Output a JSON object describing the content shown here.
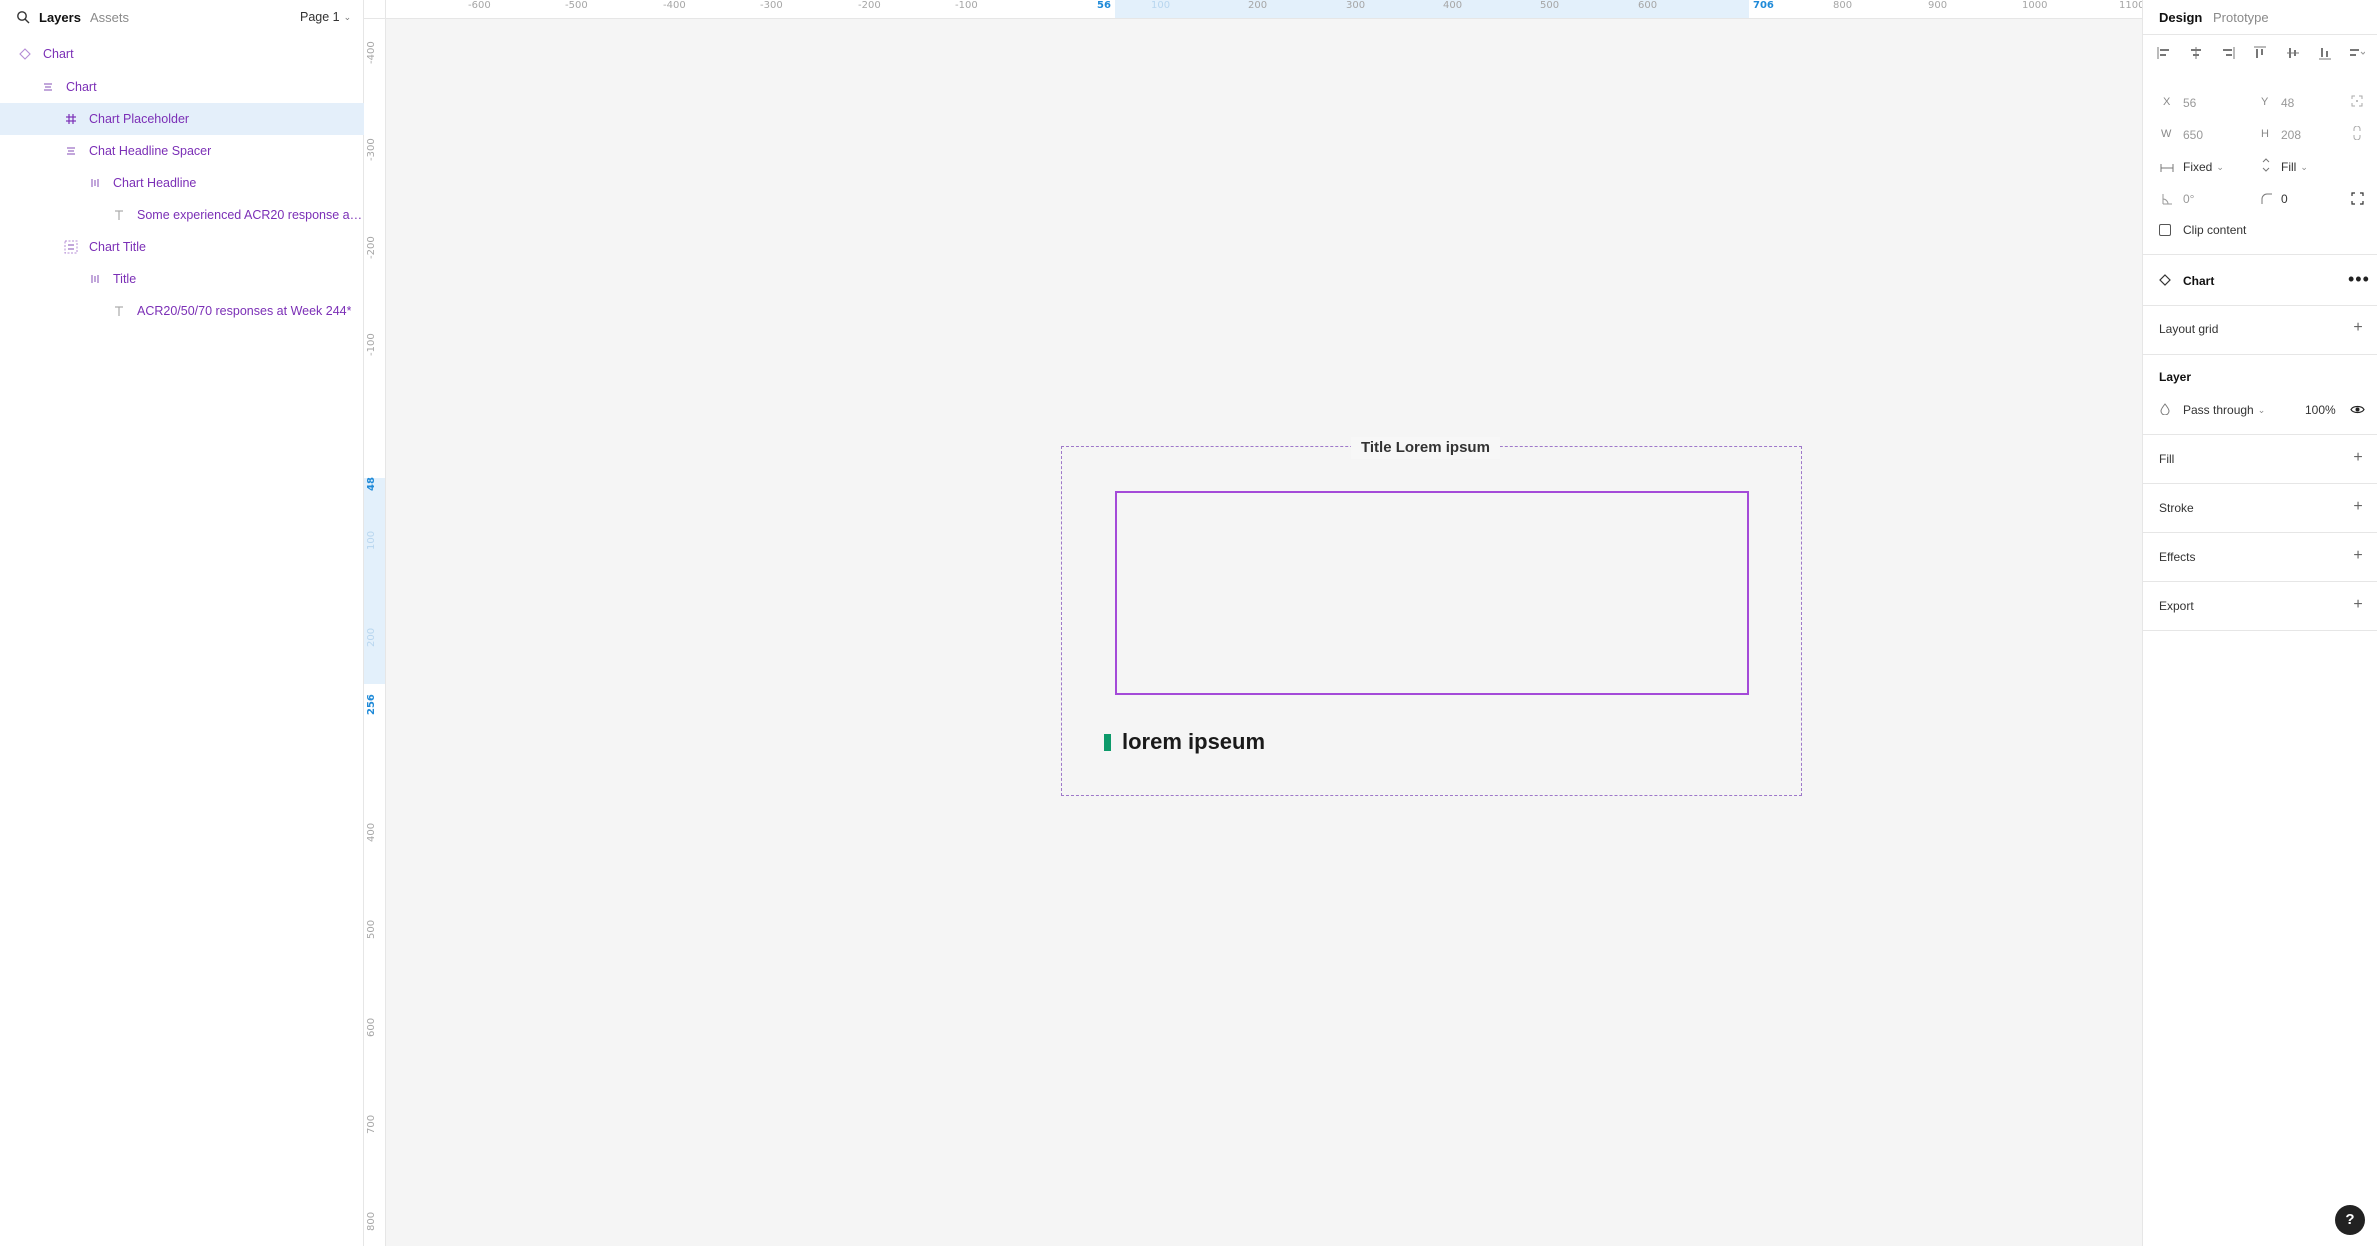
{
  "left_panel": {
    "tabs": {
      "layers": "Layers",
      "assets": "Assets"
    },
    "page_select": "Page 1",
    "layers": [
      {
        "label": "Chart",
        "icon": "component-icon"
      },
      {
        "label": "Chart",
        "icon": "auto-layout-vertical-icon"
      },
      {
        "label": "Chart Placeholder",
        "icon": "frame-icon",
        "selected": true
      },
      {
        "label": "Chat Headline Spacer",
        "icon": "auto-layout-vertical-icon"
      },
      {
        "label": "Chart Headline",
        "icon": "auto-layout-horizontal-icon"
      },
      {
        "label": "Some experienced ACR20 response as ...",
        "icon": "text-icon"
      },
      {
        "label": "Chart Title",
        "icon": "auto-layout-vertical-icon"
      },
      {
        "label": "Title",
        "icon": "auto-layout-horizontal-icon"
      },
      {
        "label": "ACR20/50/70 responses at Week 244*",
        "icon": "text-icon"
      }
    ]
  },
  "rulers": {
    "top": [
      {
        "label": "-600"
      },
      {
        "label": "-500"
      },
      {
        "label": "-400"
      },
      {
        "label": "-300"
      },
      {
        "label": "-200"
      },
      {
        "label": "-100"
      },
      {
        "label": "56",
        "highlight": true
      },
      {
        "label": "100",
        "faint": true
      },
      {
        "label": "200"
      },
      {
        "label": "300"
      },
      {
        "label": "400"
      },
      {
        "label": "500"
      },
      {
        "label": "600"
      },
      {
        "label": "706",
        "highlight": true
      },
      {
        "label": "800"
      },
      {
        "label": "900"
      },
      {
        "label": "1000"
      },
      {
        "label": "1100"
      }
    ],
    "left": [
      {
        "label": "-400"
      },
      {
        "label": "-300"
      },
      {
        "label": "-200"
      },
      {
        "label": "-100"
      },
      {
        "label": "48",
        "highlight": true
      },
      {
        "label": "100",
        "faint": true
      },
      {
        "label": "200",
        "faint": true
      },
      {
        "label": "256",
        "highlight": true
      },
      {
        "label": "400"
      },
      {
        "label": "500"
      },
      {
        "label": "600"
      },
      {
        "label": "700"
      },
      {
        "label": "800"
      }
    ]
  },
  "canvas": {
    "chart_title": "Title Lorem ipsum",
    "headline": "lorem ipseum",
    "accent_color": "#0d9a6a",
    "frame_color": "#a44ad8"
  },
  "right_panel": {
    "tabs": {
      "design": "Design",
      "prototype": "Prototype"
    },
    "x_label": "X",
    "x_value": "56",
    "y_label": "Y",
    "y_value": "48",
    "w_label": "W",
    "w_value": "650",
    "h_label": "H",
    "h_value": "208",
    "width_mode": "Fixed",
    "height_mode": "Fill",
    "rotation": "0°",
    "corner_radius": "0",
    "clip_content": "Clip content",
    "component_name": "Chart",
    "layout_grid": "Layout grid",
    "layer_section": "Layer",
    "blend_mode": "Pass through",
    "opacity": "100%",
    "fill": "Fill",
    "stroke": "Stroke",
    "effects": "Effects",
    "export": "Export"
  },
  "help": "?"
}
